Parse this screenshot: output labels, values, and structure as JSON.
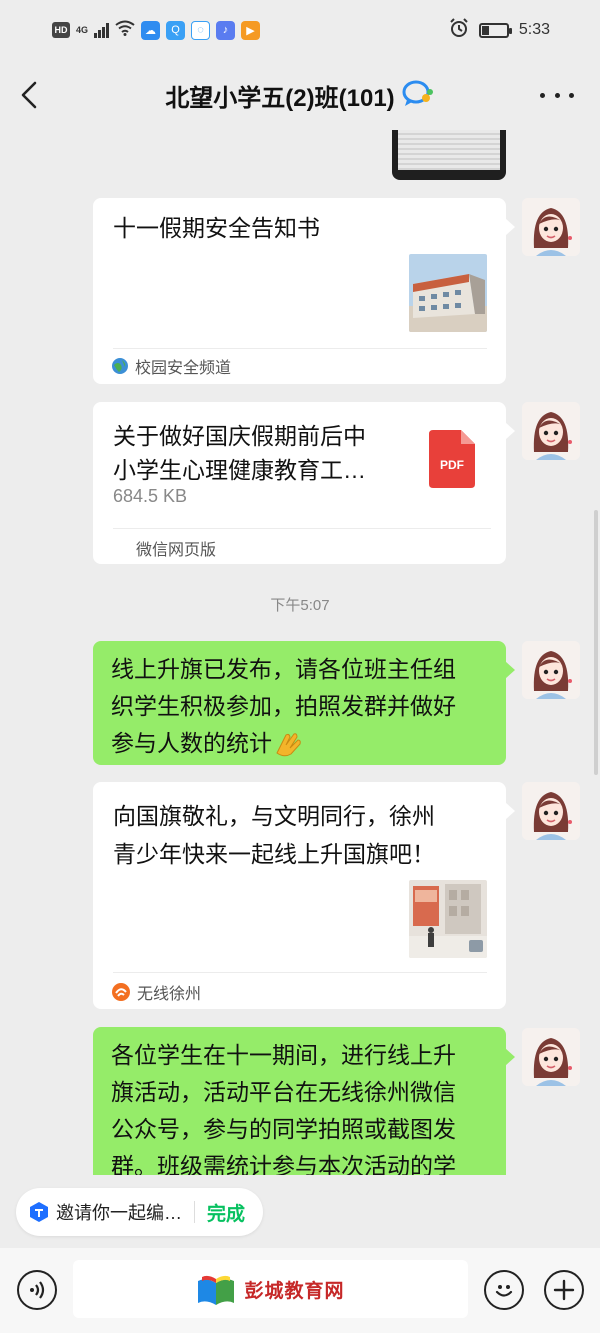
{
  "status_bar": {
    "hd": "HD",
    "network": "4G",
    "time": "5:33"
  },
  "header": {
    "title": "北望小学五(2)班(101)"
  },
  "messages": [
    {
      "type": "link-card",
      "title": "十一假期安全告知书",
      "source": "校园安全频道"
    },
    {
      "type": "file-card",
      "title_line1": "关于做好国庆假期前后中",
      "title_line2": "小学生心理健康教育工…",
      "size": "684.5 KB",
      "source": "微信网页版",
      "file_type": "PDF"
    },
    {
      "type": "timestamp",
      "text": "下午5:07"
    },
    {
      "type": "text",
      "lines": [
        "线上升旗已发布，请各位班主任组",
        "织学生积极参加，拍照发群并做好",
        "参与人数的统计"
      ]
    },
    {
      "type": "link-card",
      "title_line1": "向国旗敬礼，与文明同行，徐州",
      "title_line2": "青少年快来一起线上升国旗吧！",
      "source": "无线徐州"
    },
    {
      "type": "text",
      "lines": [
        "各位学生在十一期间，进行线上升",
        "旗活动，活动平台在无线徐州微信",
        "公众号，参与的同学拍照或截图发",
        "群。班级需统计参与本次活动的学"
      ]
    }
  ],
  "invite_bar": {
    "text": "邀请你一起编…",
    "done_label": "完成"
  },
  "input_bar": {
    "watermark": "彭城教育网"
  },
  "colors": {
    "background": "#ededed",
    "green_bubble": "#95ec69",
    "accent_green": "#07c160",
    "pdf_red": "#e8403a"
  }
}
